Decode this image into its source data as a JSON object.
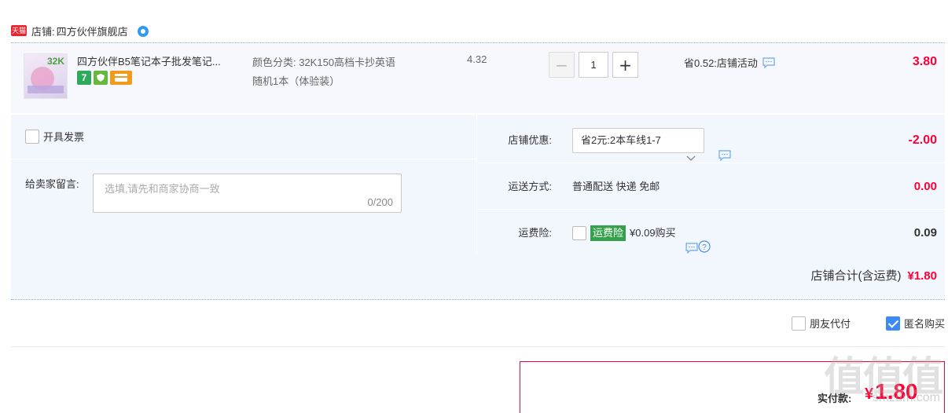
{
  "shop": {
    "badge": "天猫",
    "label": "店铺:",
    "name": "四方伙伴旗舰店"
  },
  "item": {
    "thumb_text": "32K",
    "title": "四方伙伴B5笔记本子批发笔记...",
    "tag_7": "7",
    "sku_line1": "颜色分类: 32K150高档卡抄英语",
    "sku_line2": "随机1本（体验装）",
    "unit_price": "4.32",
    "minus": "−",
    "qty": "1",
    "plus": "+",
    "saved": "省0.52:店铺活动",
    "total": "3.80"
  },
  "order": {
    "invoice_label": "开具发票",
    "message_label": "给卖家留言:",
    "message_placeholder": "选填,请先和商家协商一致",
    "message_count": "0/200",
    "shop_discount_label": "店铺优惠:",
    "shop_discount_value": "省2元:2本车线1-7",
    "shop_discount_amount": "-2.00",
    "shipping_label": "运送方式:",
    "shipping_value": "普通配送 快递 免邮",
    "shipping_amount": "0.00",
    "insurance_label": "运费险:",
    "insurance_tag": "运费险",
    "insurance_price": "¥0.09购买",
    "insurance_amount": "0.09",
    "subtotal_label": "店铺合计(含运费)",
    "subtotal_amount": "¥1.80"
  },
  "options": {
    "friend_pay": "朋友代付",
    "anonymous": "匿名购买"
  },
  "payment": {
    "label": "实付款:",
    "yen": "¥",
    "amount": "1.80"
  },
  "watermark": {
    "main": "值值值",
    "sub": "smzdm.com"
  },
  "colors": {
    "accent_red": "#ff0036",
    "panel_bg": "#f2f6fd",
    "insurance_green": "#35a24b",
    "check_blue": "#3d8af7"
  }
}
